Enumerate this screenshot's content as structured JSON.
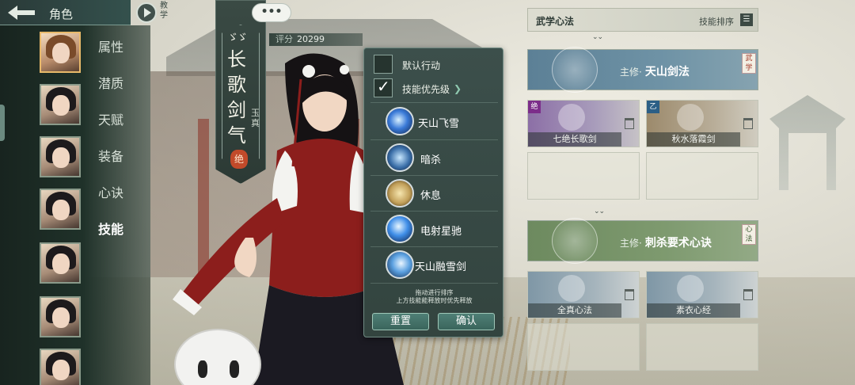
{
  "header": {
    "title": "角色",
    "tutorial_label": "教学"
  },
  "sidebar": {
    "items": [
      {
        "label": "属性"
      },
      {
        "label": "潜质"
      },
      {
        "label": "天赋"
      },
      {
        "label": "装备"
      },
      {
        "label": "心诀"
      },
      {
        "label": "技能",
        "active": true
      }
    ],
    "portrait_count": 7
  },
  "character": {
    "name": "长歌剑气",
    "school": "玉真",
    "seal": "绝",
    "marks": "ゞゞ",
    "score_label": "评分",
    "score_value": "20299",
    "chat": "•••"
  },
  "popup": {
    "default_action_label": "默认行动",
    "default_action_checked": false,
    "skill_priority_label": "技能优先级",
    "skill_priority_checked": true,
    "skills": [
      {
        "name": "天山飞雪",
        "icon": "sword-thrust-icon"
      },
      {
        "name": "暗杀",
        "icon": "whirlwind-icon"
      },
      {
        "name": "休息",
        "icon": "meditation-icon"
      },
      {
        "name": "电射星驰",
        "icon": "lightning-icon"
      },
      {
        "name": "天山融雪剑",
        "icon": "ice-sword-icon"
      }
    ],
    "hint_line1": "拖动进行排序",
    "hint_line2": "上方技能能释放时优先释放",
    "reset_label": "重置",
    "confirm_label": "确认"
  },
  "martial": {
    "title": "武学心法",
    "sort_label": "技能排序",
    "main_sword": {
      "prefix": "主修·",
      "name": "天山剑法",
      "tag": "武学"
    },
    "sword_slots": [
      {
        "name": "七绝长歌剑",
        "badge": "绝"
      },
      {
        "name": "秋水落霞剑",
        "badge": "乙"
      },
      {
        "name": ""
      },
      {
        "name": ""
      }
    ],
    "main_inner": {
      "prefix": "主修·",
      "name": "刺杀要术心诀",
      "tag": "心法"
    },
    "inner_slots": [
      {
        "name": "全真心法"
      },
      {
        "name": "素衣心经"
      },
      {
        "name": ""
      },
      {
        "name": ""
      }
    ]
  },
  "colors": {
    "panel_dark": "#1f3129",
    "popup_bg": "#3c4f4b",
    "button_teal": "#4f7f76",
    "sword_card": "#6f93a6",
    "inner_card": "#7e9a6f",
    "seal_red": "#c24a2a"
  }
}
